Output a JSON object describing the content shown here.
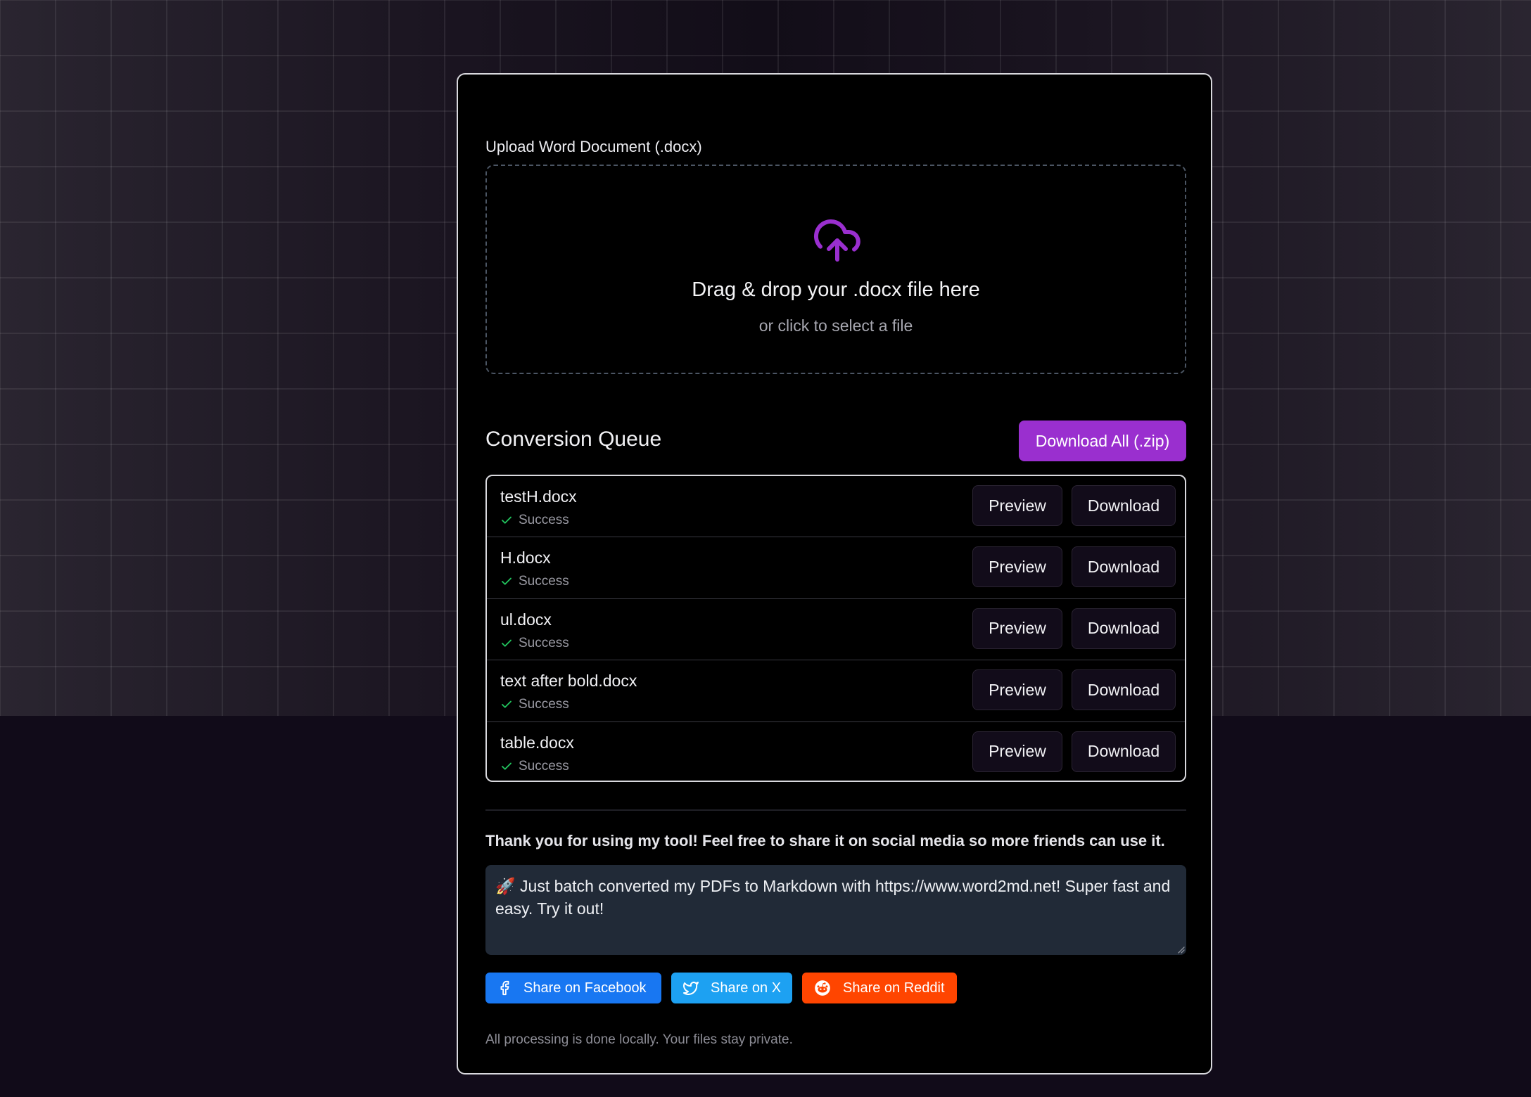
{
  "upload": {
    "label": "Upload Word Document (.docx)",
    "drop_title": "Drag & drop your .docx file here",
    "drop_subtitle": "or click to select a file",
    "icon": "cloud-upload-icon"
  },
  "queue": {
    "title": "Conversion Queue",
    "download_all_label": "Download All (.zip)",
    "preview_label": "Preview",
    "download_label": "Download",
    "items": [
      {
        "filename": "testH.docx",
        "status": "Success"
      },
      {
        "filename": "H.docx",
        "status": "Success"
      },
      {
        "filename": "ul.docx",
        "status": "Success"
      },
      {
        "filename": "text after bold.docx",
        "status": "Success"
      },
      {
        "filename": "table.docx",
        "status": "Success"
      }
    ]
  },
  "share": {
    "thanks": "Thank you for using my tool! Feel free to share it on social media so more friends can use it.",
    "message": "🚀 Just batch converted my PDFs to Markdown with https://www.word2md.net! Super fast and easy. Try it out!",
    "facebook_label": "Share on Facebook",
    "x_label": "Share on X",
    "reddit_label": "Share on Reddit"
  },
  "footer": {
    "note": "All processing is done locally. Your files stay private."
  },
  "colors": {
    "accent": "#9a2fcf",
    "success": "#22c55e",
    "facebook": "#1877f2",
    "x": "#1da1f2",
    "reddit": "#ff4500"
  }
}
